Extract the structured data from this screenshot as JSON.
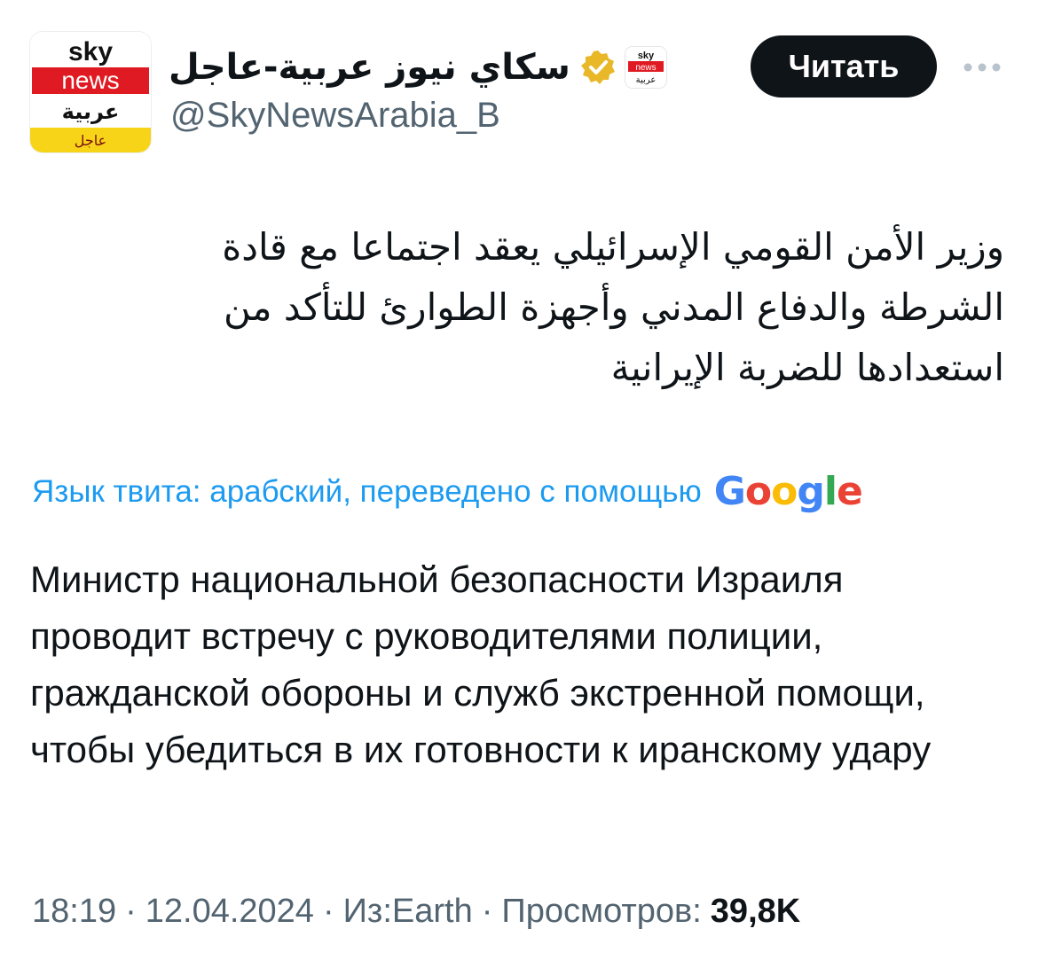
{
  "account": {
    "display_name": "سكاي نيوز عربية-عاجل",
    "handle": "@SkyNewsArabia_B",
    "verified_icon": "gold-verified-check-icon",
    "avatar_logo_lines": [
      "sky",
      "news",
      "عربية",
      "عاجل"
    ],
    "affiliate_logo_lines": [
      "sky",
      "news",
      "عربية"
    ]
  },
  "actions": {
    "read_label": "Читать",
    "more_icon": "more-horizontal-icon"
  },
  "tweet": {
    "original_text": "وزير الأمن القومي الإسرائيلي يعقد اجتماعا مع قادة الشرطة والدفاع المدني وأجهزة الطوارئ للتأكد من استعدادها للضربة الإيرانية",
    "translation_note": "Язык твита: арабский, переведено с помощью",
    "translation_provider": "Google",
    "translated_text": "Министр национальной безопасности Израиля проводит встречу с руководителями полиции, гражданской обороны и служб экстренной помощи, чтобы убедиться в их готовности к иранскому удару"
  },
  "meta": {
    "time": "18:19",
    "date": "12.04.2024",
    "source": "Из:Earth",
    "views_label": "Просмотров:",
    "views_count": "39,8K",
    "separator": "·"
  },
  "colors": {
    "text": "#0f1419",
    "secondary": "#536471",
    "link": "#1d9bf0",
    "button_bg": "#0f1419",
    "sky_red": "#e01a22",
    "sky_yellow": "#f7d417",
    "verified_gold": "#e8b829"
  }
}
